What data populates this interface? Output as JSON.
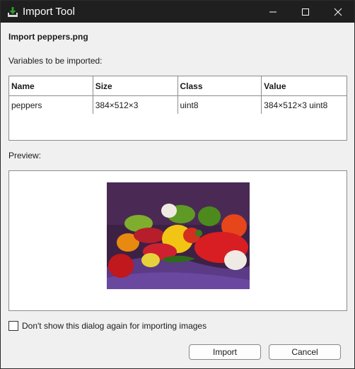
{
  "window": {
    "title": "Import Tool"
  },
  "dialog": {
    "heading": "Import peppers.png",
    "variables_label": "Variables to be imported:",
    "preview_label": "Preview:",
    "checkbox_label": "Don't show this dialog again for importing images",
    "checkbox_checked": false
  },
  "table": {
    "headers": [
      "Name",
      "Size",
      "Class",
      "Value"
    ],
    "rows": [
      [
        "peppers",
        "384×512×3",
        "uint8",
        "384×512×3 uint8"
      ]
    ]
  },
  "buttons": {
    "import": "Import",
    "cancel": "Cancel"
  },
  "icons": {
    "app": "import-download-icon",
    "minimize": "minimize-icon",
    "maximize": "maximize-icon",
    "close": "close-icon"
  }
}
